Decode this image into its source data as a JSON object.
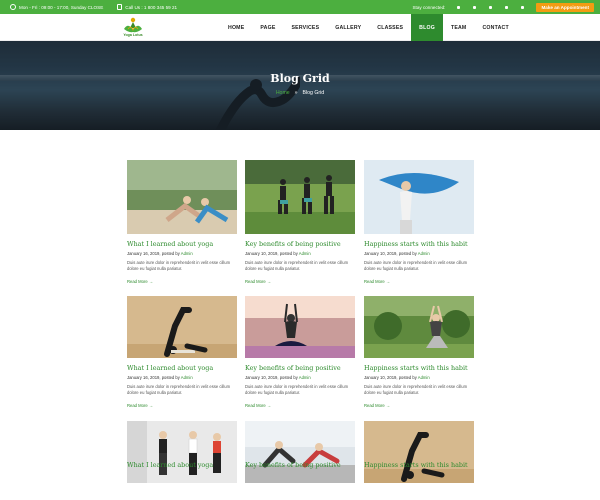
{
  "topbar": {
    "hours": "Mon - Fri : 09:00 - 17:00, Sunday CLOSE",
    "phone": "Call Us : 1 800 345 59 21",
    "stay_connected": "Stay connected:",
    "social_icons": [
      "facebook-icon",
      "twitter-icon",
      "instagram-icon",
      "pinterest-icon",
      "google-plus-icon"
    ],
    "appointment_button": "Make an Appointment",
    "accent": "#4caf3f",
    "button_color": "#f39c12"
  },
  "nav": {
    "logo_text": "Yoga Lotus",
    "items": [
      "HOME",
      "PAGE",
      "SERVICES",
      "GALLERY",
      "CLASSES",
      "BLOG",
      "TEAM",
      "CONTACT"
    ],
    "active": "BLOG",
    "active_color": "#2e8b2e"
  },
  "hero": {
    "title": "Blog Grid",
    "breadcrumb_home": "Home",
    "breadcrumb_sep": "»",
    "breadcrumb_current": "Blog Grid"
  },
  "posts": [
    {
      "title": "What I learned about yoga",
      "meta_prefix": "January 16, 2019, posted by ",
      "author": "Admin",
      "excerpt": "Duis aute irure dolor in reprehenderit in velit esse cillum dolore eu fugiat nulla pariatur.",
      "read_more": "Read More →",
      "image": "two-women-stretching-outdoors"
    },
    {
      "title": "Key benefits of being positive",
      "meta_prefix": "January 10, 2019, posted by ",
      "author": "Admin",
      "excerpt": "Duis aute irure dolor in reprehenderit in velit esse cillum dolore eu fugiat nulla pariatur.",
      "read_more": "Read More →",
      "image": "group-yoga-on-grass"
    },
    {
      "title": "Happiness starts with this habit",
      "meta_prefix": "January 10, 2019, posted by ",
      "author": "Admin",
      "excerpt": "Duis aute irure dolor in reprehenderit in velit esse cillum dolore eu fugiat nulla pariatur.",
      "read_more": "Read More →",
      "image": "woman-with-blue-scarf"
    },
    {
      "title": "What I learned about yoga",
      "meta_prefix": "January 16, 2019, posted by ",
      "author": "Admin",
      "excerpt": "Duis aute irure dolor in reprehenderit in velit esse cillum dolore eu fugiat nulla pariatur.",
      "read_more": "Read More →",
      "image": "yoga-pose-indoor"
    },
    {
      "title": "Key benefits of being positive",
      "meta_prefix": "January 10, 2019, posted by ",
      "author": "Admin",
      "excerpt": "Duis aute irure dolor in reprehenderit in velit esse cillum dolore eu fugiat nulla pariatur.",
      "read_more": "Read More →",
      "image": "meditation-at-sunset"
    },
    {
      "title": "Happiness starts with this habit",
      "meta_prefix": "January 10, 2019, posted by ",
      "author": "Admin",
      "excerpt": "Duis aute irure dolor in reprehenderit in velit esse cillum dolore eu fugiat nulla pariatur.",
      "read_more": "Read More →",
      "image": "woman-in-garden"
    },
    {
      "title": "What I learned about yoga",
      "meta_prefix": "",
      "author": "",
      "excerpt": "",
      "read_more": "",
      "image": "fitness-class"
    },
    {
      "title": "Key benefits of being positive",
      "meta_prefix": "",
      "author": "",
      "excerpt": "",
      "read_more": "",
      "image": "gym-stretching"
    },
    {
      "title": "Happiness starts with this habit",
      "meta_prefix": "",
      "author": "",
      "excerpt": "",
      "read_more": "",
      "image": "yoga-pose-indoor"
    }
  ]
}
